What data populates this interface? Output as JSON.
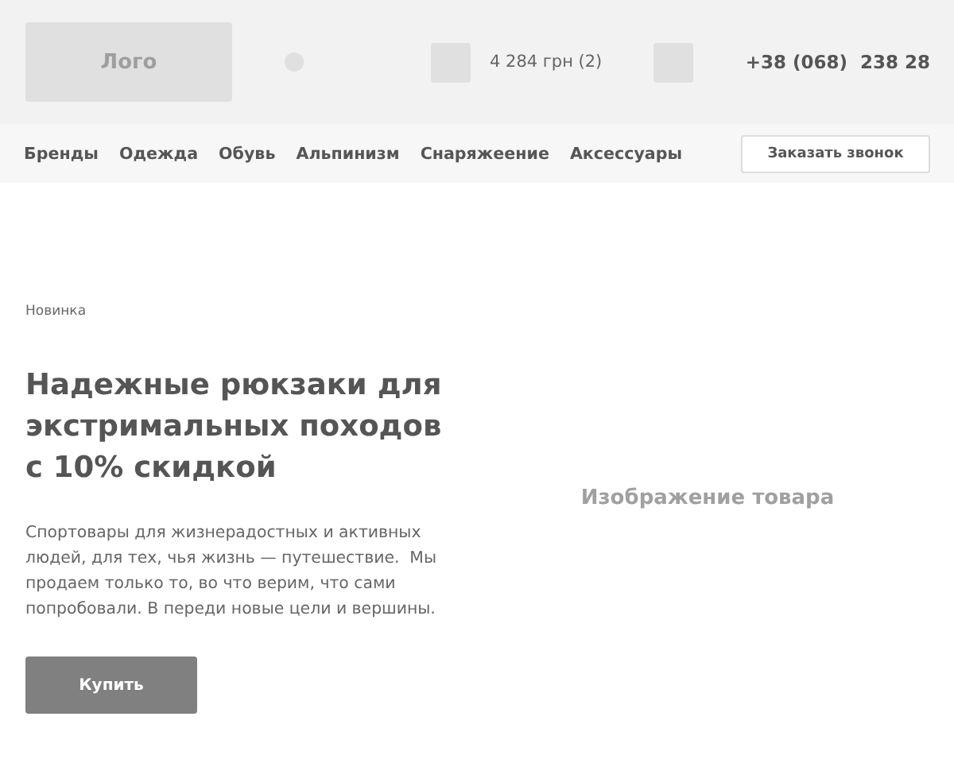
{
  "header": {
    "logo": "Лого",
    "cart_total": "4 284 грн (2)",
    "phone": "+38 (068)  238 28"
  },
  "nav": {
    "items": [
      "Бренды",
      "Одежда",
      "Обувь",
      "Альпинизм",
      "Снаряжеение",
      "Аксессуары"
    ],
    "callback_button": "Заказать звонок"
  },
  "hero": {
    "badge": "Новинка",
    "title": "Надежные рюкзаки для экстримальных походов с 10% скидкой",
    "description": "Спортовары для жизнерадостных и активных людей, для тех, чья жизнь — путешествие.  Мы продаем только то, во что верим, что сами попробовали. В переди новые цели и вершины.",
    "buy_button": "Купить",
    "image_placeholder": "Изображение товара"
  }
}
